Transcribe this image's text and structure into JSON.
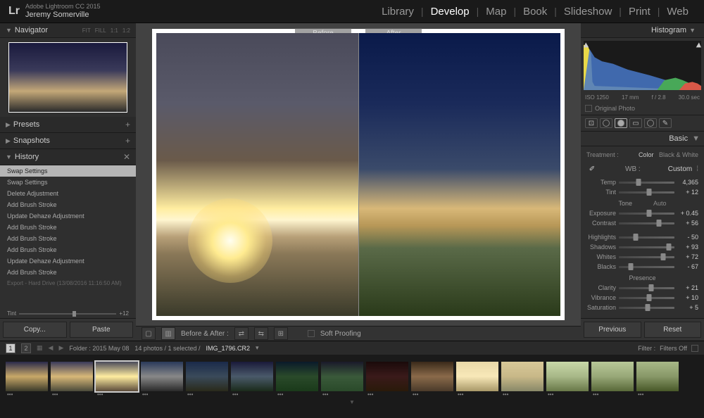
{
  "header": {
    "logo": "Lr",
    "app_name": "Adobe Lightroom CC 2015",
    "user_name": "Jeremy Somerville",
    "modules": [
      "Library",
      "Develop",
      "Map",
      "Book",
      "Slideshow",
      "Print",
      "Web"
    ],
    "active_module": "Develop"
  },
  "left": {
    "navigator": {
      "title": "Navigator",
      "zoom_opts": [
        "FIT",
        "FILL",
        "1:1",
        "1:2"
      ]
    },
    "presets": {
      "title": "Presets"
    },
    "snapshots": {
      "title": "Snapshots"
    },
    "history": {
      "title": "History",
      "items": [
        "Swap Settings",
        "Swap Settings",
        "Delete Adjustment",
        "Add Brush Stroke",
        "Update Dehaze Adjustment",
        "Add Brush Stroke",
        "Add Brush Stroke",
        "Add Brush Stroke",
        "Update Dehaze Adjustment",
        "Add Brush Stroke",
        "Export - Hard Drive (13/08/2016 11:16:50 AM)"
      ],
      "tint_label": "Tint",
      "tint_val": "+12"
    },
    "copy_btn": "Copy...",
    "paste_btn": "Paste"
  },
  "center": {
    "before_label": "Before",
    "after_label": "After",
    "ba_label": "Before & After :",
    "soft_proof": "Soft Proofing"
  },
  "right": {
    "histogram": {
      "title": "Histogram",
      "iso": "ISO 1250",
      "focal": "17 mm",
      "aperture": "f / 2.8",
      "shutter": "30.0 sec",
      "orig": "Original Photo"
    },
    "basic": {
      "title": "Basic",
      "treatment": "Treatment :",
      "color": "Color",
      "bw": "Black & White",
      "wb_label": "WB :",
      "wb_value": "Custom",
      "temp": {
        "label": "Temp",
        "val": "4,365",
        "pos": 35
      },
      "tint": {
        "label": "Tint",
        "val": "+ 12",
        "pos": 55
      },
      "tone_title": "Tone",
      "auto": "Auto",
      "exposure": {
        "label": "Exposure",
        "val": "+ 0.45",
        "pos": 55
      },
      "contrast": {
        "label": "Contrast",
        "val": "+ 56",
        "pos": 72
      },
      "highlights": {
        "label": "Highlights",
        "val": "- 50",
        "pos": 30
      },
      "shadows": {
        "label": "Shadows",
        "val": "+ 93",
        "pos": 90
      },
      "whites": {
        "label": "Whites",
        "val": "+ 72",
        "pos": 80
      },
      "blacks": {
        "label": "Blacks",
        "val": "- 67",
        "pos": 22
      },
      "presence_title": "Presence",
      "clarity": {
        "label": "Clarity",
        "val": "+ 21",
        "pos": 58
      },
      "vibrance": {
        "label": "Vibrance",
        "val": "+ 10",
        "pos": 54
      },
      "saturation": {
        "label": "Saturation",
        "val": "+ 5",
        "pos": 52
      }
    },
    "previous_btn": "Previous",
    "reset_btn": "Reset"
  },
  "filmstrip": {
    "folder": "Folder : 2015 May 08",
    "count": "14 photos / 1 selected /",
    "filename": "IMG_1796.CR2",
    "filter_label": "Filter :",
    "filter_state": "Filters Off",
    "thumbs": 15
  }
}
